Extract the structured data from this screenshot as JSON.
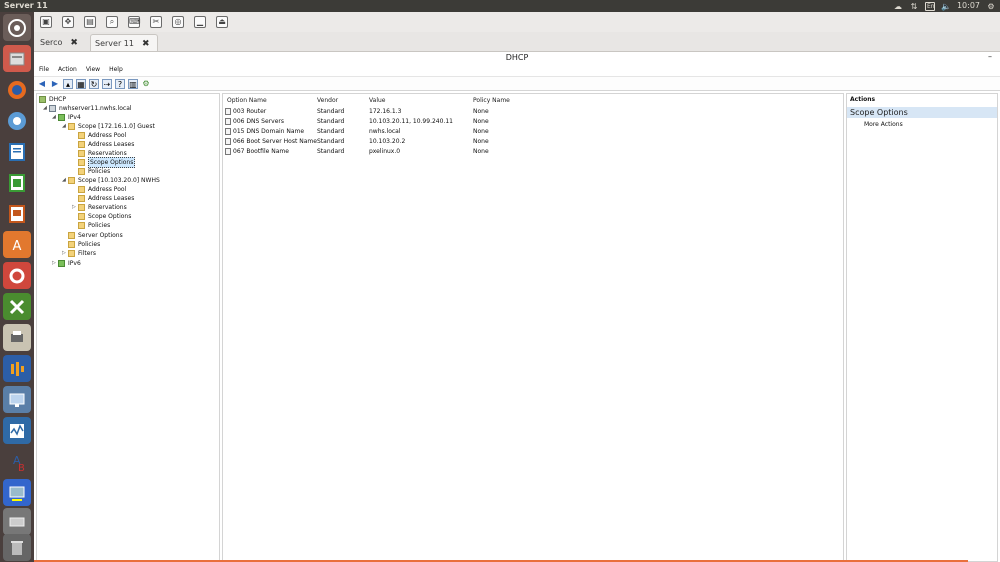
{
  "top_panel": {
    "title": "Server 11",
    "lang": "En",
    "time": "10:07"
  },
  "tabs": [
    {
      "label": "Serco"
    },
    {
      "label": "Server 11"
    }
  ],
  "mmc": {
    "title": "DHCP",
    "menu": [
      "File",
      "Action",
      "View",
      "Help"
    ]
  },
  "tree": {
    "items": [
      {
        "label": "DHCP"
      },
      {
        "label": "nwhserver11.nwhs.local"
      },
      {
        "label": "IPv4"
      },
      {
        "label": "Scope [172.16.1.0] Guest"
      },
      {
        "label": "Address Pool"
      },
      {
        "label": "Address Leases"
      },
      {
        "label": "Reservations"
      },
      {
        "label": "Scope Options"
      },
      {
        "label": "Policies"
      },
      {
        "label": "Scope [10.103.20.0] NWHS"
      },
      {
        "label": "Address Pool"
      },
      {
        "label": "Address Leases"
      },
      {
        "label": "Reservations"
      },
      {
        "label": "Scope Options"
      },
      {
        "label": "Policies"
      },
      {
        "label": "Server Options"
      },
      {
        "label": "Policies"
      },
      {
        "label": "Filters"
      },
      {
        "label": "IPv6"
      }
    ]
  },
  "list": {
    "columns": [
      "Option Name",
      "Vendor",
      "Value",
      "Policy Name"
    ],
    "rows": [
      {
        "name": "003 Router",
        "vendor": "Standard",
        "value": "172.16.1.3",
        "policy": "None"
      },
      {
        "name": "006 DNS Servers",
        "vendor": "Standard",
        "value": "10.103.20.11, 10.99.240.11",
        "policy": "None"
      },
      {
        "name": "015 DNS Domain Name",
        "vendor": "Standard",
        "value": "nwhs.local",
        "policy": "None"
      },
      {
        "name": "066 Boot Server Host Name",
        "vendor": "Standard",
        "value": "10.103.20.2",
        "policy": "None"
      },
      {
        "name": "067 Bootfile Name",
        "vendor": "Standard",
        "value": "pxelinux.0",
        "policy": "None"
      }
    ]
  },
  "actions": {
    "header": "Actions",
    "section": "Scope Options",
    "more": "More Actions"
  }
}
